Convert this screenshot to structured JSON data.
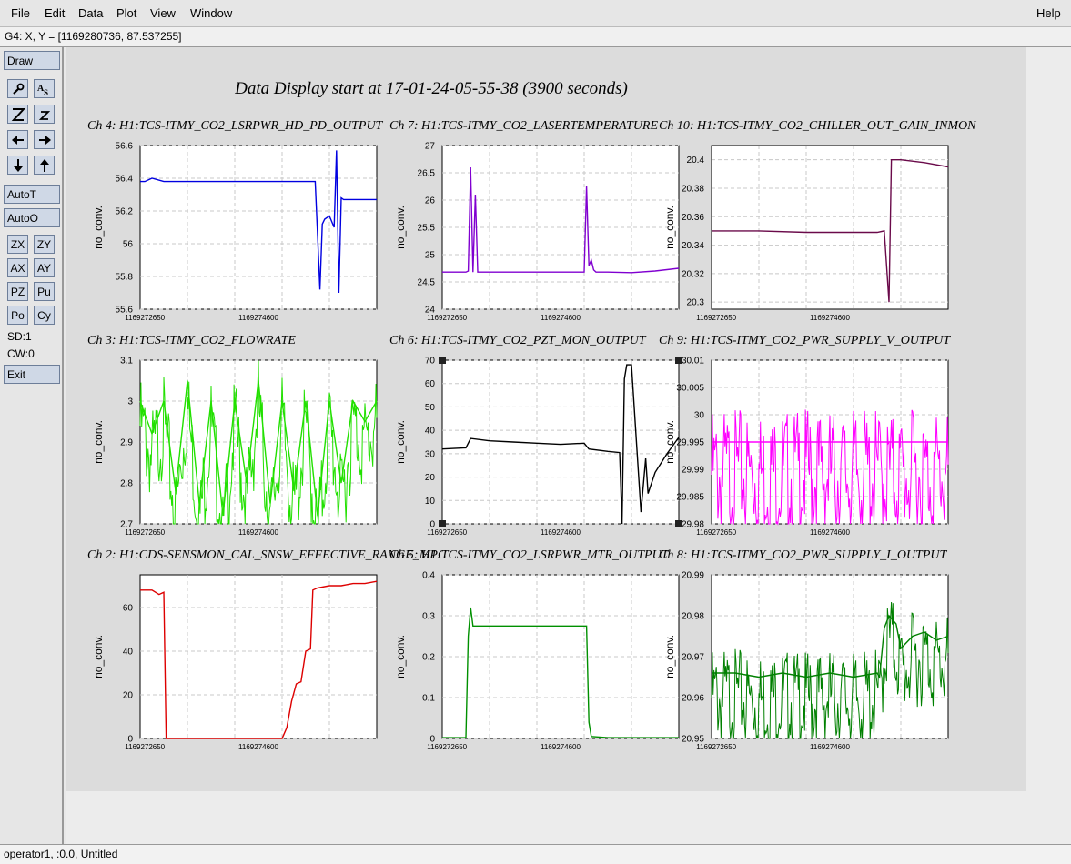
{
  "menu": {
    "items": [
      "File",
      "Edit",
      "Data",
      "Plot",
      "View",
      "Window"
    ],
    "help": "Help"
  },
  "coords_text": "G4: X, Y = [1169280736, 87.537255]",
  "toolbox": {
    "draw": "Draw",
    "icons": [
      "magnify-icon",
      "text-icon",
      "zoom-in-icon",
      "zoom-out-icon",
      "arrow-left-icon",
      "arrow-right-icon",
      "arrow-down-icon",
      "arrow-up-icon"
    ],
    "autot": "AutoT",
    "autoo": "AutoO",
    "small_buttons": [
      "ZX",
      "ZY",
      "AX",
      "AY",
      "PZ",
      "Pu",
      "Po",
      "Cy"
    ],
    "sd": "SD:1",
    "cw": "CW:0",
    "exit": "Exit"
  },
  "status_text": "operator1, :0.0, Untitled",
  "display_title": "Data Display start at 17-01-24-05-55-38 (3900 seconds)",
  "chart_data": [
    {
      "type": "line",
      "title": "Ch 4: H1:TCS-ITMY_CO2_LSRPWR_HD_PD_OUTPUT",
      "ylabel": "no_conv.",
      "color": "#0000e0",
      "yticks": [
        "56.6",
        "56.4",
        "56.2",
        "56",
        "55.8",
        "55.6"
      ],
      "ylim": [
        55.6,
        56.6
      ],
      "xticks": [
        "1169272650",
        "1169274600"
      ],
      "x": [
        0,
        0.02,
        0.05,
        0.1,
        0.15,
        0.2,
        0.25,
        0.3,
        0.35,
        0.4,
        0.45,
        0.5,
        0.55,
        0.6,
        0.65,
        0.7,
        0.72,
        0.74,
        0.75,
        0.76,
        0.77,
        0.78,
        0.8,
        0.82,
        0.83,
        0.84,
        0.85,
        0.86,
        0.9,
        0.95,
        1
      ],
      "values": [
        56.38,
        56.38,
        56.4,
        56.38,
        56.38,
        56.38,
        56.38,
        56.38,
        56.38,
        56.38,
        56.38,
        56.38,
        56.38,
        56.38,
        56.38,
        56.38,
        56.38,
        56.38,
        56.05,
        55.72,
        56.12,
        56.15,
        56.17,
        56.1,
        56.57,
        55.7,
        56.28,
        56.27,
        56.27,
        56.27,
        56.27
      ]
    },
    {
      "type": "line",
      "title": "Ch 7: H1:TCS-ITMY_CO2_LASERTEMPERATURE",
      "ylabel": "no_conv.",
      "color": "#8000d0",
      "yticks": [
        "27",
        "26.5",
        "26",
        "25.5",
        "25",
        "24.5",
        "24"
      ],
      "ylim": [
        24,
        27
      ],
      "xticks": [
        "1169272650",
        "1169274600"
      ],
      "x": [
        0,
        0.1,
        0.11,
        0.12,
        0.13,
        0.14,
        0.15,
        0.2,
        0.3,
        0.4,
        0.5,
        0.6,
        0.61,
        0.62,
        0.63,
        0.64,
        0.65,
        0.7,
        0.8,
        0.9,
        1
      ],
      "values": [
        24.68,
        24.68,
        24.7,
        26.6,
        24.68,
        26.1,
        24.68,
        24.68,
        24.68,
        24.68,
        24.68,
        24.68,
        26.25,
        24.8,
        24.9,
        24.72,
        24.68,
        24.68,
        24.67,
        24.7,
        24.75
      ]
    },
    {
      "type": "line",
      "title": "Ch 10: H1:TCS-ITMY_CO2_CHILLER_OUT_GAIN_INMON",
      "ylabel": "no_conv.",
      "color": "#6a0a4a",
      "yticks": [
        "20.4",
        "20.38",
        "20.36",
        "20.34",
        "20.32",
        "20.3"
      ],
      "ylim": [
        20.295,
        20.41
      ],
      "xticks": [
        "1169272650",
        "1169274600"
      ],
      "x": [
        0,
        0.2,
        0.4,
        0.6,
        0.7,
        0.73,
        0.75,
        0.76,
        0.8,
        0.9,
        1
      ],
      "values": [
        20.35,
        20.35,
        20.349,
        20.349,
        20.349,
        20.35,
        20.3,
        20.4,
        20.4,
        20.398,
        20.395
      ]
    },
    {
      "type": "line",
      "title": "Ch 3: H1:TCS-ITMY_CO2_FLOWRATE",
      "ylabel": "no_conv.",
      "color": "#22e000",
      "yticks": [
        "3.1",
        "3",
        "2.9",
        "2.8",
        "2.7"
      ],
      "ylim": [
        2.7,
        3.1
      ],
      "xticks": [
        "1169272650",
        "1169274600"
      ],
      "x": [
        0,
        0.05,
        0.1,
        0.15,
        0.2,
        0.25,
        0.3,
        0.35,
        0.4,
        0.45,
        0.5,
        0.55,
        0.6,
        0.65,
        0.7,
        0.75,
        0.8,
        0.85,
        0.9,
        0.95,
        1
      ],
      "values": [
        3.0,
        2.92,
        3.0,
        2.78,
        3.05,
        2.75,
        3.0,
        2.72,
        3.0,
        2.8,
        3.05,
        2.75,
        3.0,
        2.78,
        3.0,
        2.72,
        3.0,
        2.8,
        3.0,
        2.95,
        3.0
      ]
    },
    {
      "type": "line",
      "title": "Ch 6: H1:TCS-ITMY_CO2_PZT_MON_OUTPUT",
      "ylabel": "no_conv.",
      "color": "#000000",
      "yticks": [
        "70",
        "60",
        "50",
        "40",
        "30",
        "20",
        "10",
        "0"
      ],
      "ylim": [
        0,
        70
      ],
      "xticks": [
        "1169272650",
        "1169274600"
      ],
      "x": [
        0,
        0.1,
        0.12,
        0.2,
        0.3,
        0.4,
        0.5,
        0.6,
        0.62,
        0.7,
        0.75,
        0.76,
        0.77,
        0.78,
        0.8,
        0.84,
        0.86,
        0.87,
        0.9,
        0.95,
        1
      ],
      "values": [
        32,
        32.5,
        36.5,
        35.5,
        35,
        34.5,
        34,
        34.5,
        32,
        31,
        30.5,
        0,
        62,
        68,
        68,
        5,
        28,
        13,
        22,
        30,
        37
      ]
    },
    {
      "type": "line",
      "title": "Ch 9: H1:TCS-ITMY_CO2_PWR_SUPPLY_V_OUTPUT",
      "ylabel": "no_conv.",
      "color": "#ff00ff",
      "yticks": [
        "30.01",
        "30.005",
        "30",
        "29.995",
        "29.99",
        "29.985",
        "29.98"
      ],
      "ylim": [
        29.98,
        30.01
      ],
      "xticks": [
        "1169272650",
        "1169274600"
      ],
      "x": [
        0,
        0.1,
        0.2,
        0.3,
        0.4,
        0.5,
        0.6,
        0.7,
        0.8,
        0.9,
        1
      ],
      "values": [
        29.995,
        29.995,
        29.995,
        29.995,
        29.995,
        29.995,
        29.995,
        29.995,
        29.995,
        29.995,
        29.995
      ]
    },
    {
      "type": "line",
      "title": "Ch 2: H1:CDS-SENSMON_CAL_SNSW_EFFECTIVE_RANGE_MPC",
      "ylabel": "no_conv.",
      "color": "#dd0000",
      "yticks": [
        "60",
        "40",
        "20",
        "0"
      ],
      "ylim": [
        0,
        75
      ],
      "xticks": [
        "1169272650",
        "1169274600"
      ],
      "x": [
        0,
        0.05,
        0.08,
        0.1,
        0.11,
        0.2,
        0.4,
        0.6,
        0.62,
        0.64,
        0.66,
        0.68,
        0.7,
        0.72,
        0.73,
        0.75,
        0.8,
        0.85,
        0.9,
        0.95,
        1
      ],
      "values": [
        68,
        68,
        66,
        67,
        0,
        0,
        0,
        0,
        5,
        17,
        25,
        26,
        40,
        41,
        68,
        69,
        70,
        70,
        71,
        71,
        72
      ]
    },
    {
      "type": "line",
      "title": "Ch 5: H1:TCS-ITMY_CO2_LSRPWR_MTR_OUTPUT",
      "ylabel": "no_conv.",
      "color": "#009000",
      "yticks": [
        "0.4",
        "0.3",
        "0.2",
        "0.1",
        "0"
      ],
      "ylim": [
        0,
        0.4
      ],
      "xticks": [
        "1169272650",
        "1169274600"
      ],
      "x": [
        0,
        0.1,
        0.11,
        0.12,
        0.13,
        0.2,
        0.4,
        0.6,
        0.61,
        0.62,
        0.63,
        0.7,
        0.8,
        0.9,
        1
      ],
      "values": [
        0.002,
        0.002,
        0.25,
        0.32,
        0.275,
        0.275,
        0.275,
        0.275,
        0.275,
        0.04,
        0.005,
        0.002,
        0.002,
        0.002,
        0.002
      ]
    },
    {
      "type": "line",
      "title": "Ch 8: H1:TCS-ITMY_CO2_PWR_SUPPLY_I_OUTPUT",
      "ylabel": "no_conv.",
      "color": "#008000",
      "yticks": [
        "20.99",
        "20.98",
        "20.97",
        "20.96",
        "20.95"
      ],
      "ylim": [
        20.95,
        20.99
      ],
      "xticks": [
        "1169272650",
        "1169274600"
      ],
      "x": [
        0,
        0.1,
        0.2,
        0.3,
        0.4,
        0.5,
        0.6,
        0.7,
        0.71,
        0.73,
        0.75,
        0.78,
        0.8,
        0.85,
        0.9,
        0.95,
        1
      ],
      "values": [
        20.966,
        20.966,
        20.965,
        20.966,
        20.965,
        20.966,
        20.965,
        20.966,
        20.965,
        20.977,
        20.98,
        20.978,
        20.972,
        20.975,
        20.976,
        20.974,
        20.975
      ]
    }
  ]
}
